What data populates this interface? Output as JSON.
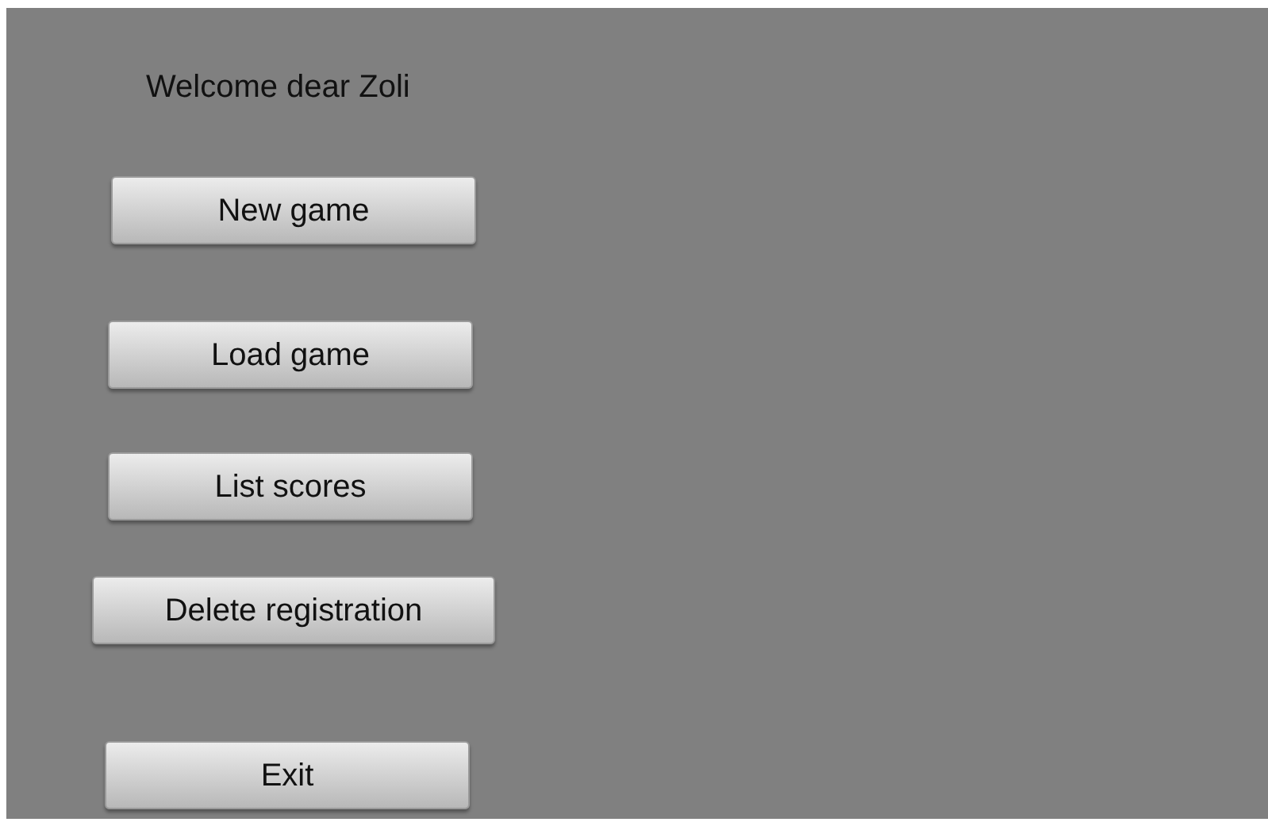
{
  "welcome": "Welcome dear Zoli",
  "buttons": [
    {
      "label": "New game"
    },
    {
      "label": "Load game"
    },
    {
      "label": "List scores"
    },
    {
      "label": "Delete registration"
    },
    {
      "label": "Exit"
    }
  ]
}
